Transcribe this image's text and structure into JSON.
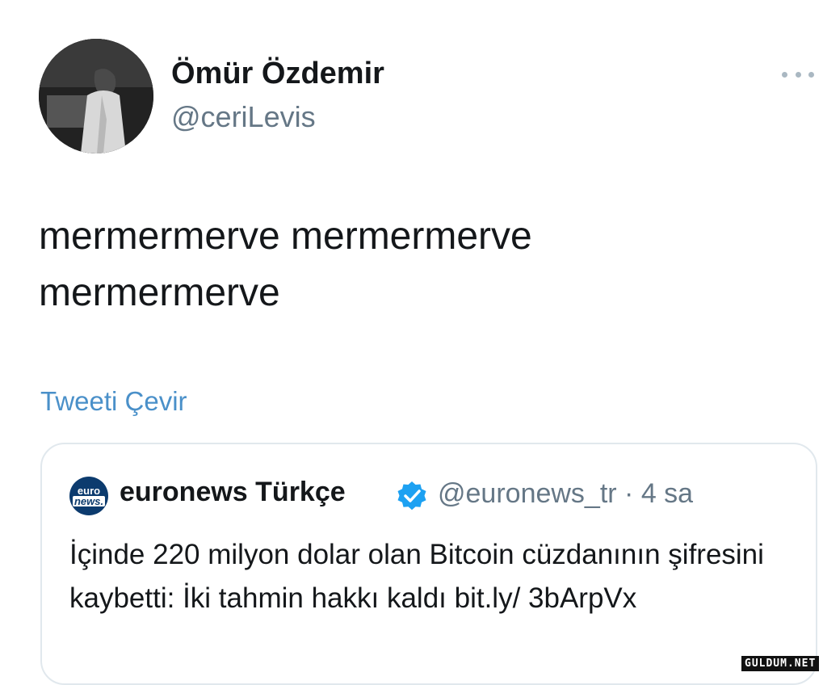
{
  "tweet": {
    "author": {
      "display_name": "Ömür Özdemir",
      "handle": "@ceriLevis",
      "avatar_icon": "user-photo"
    },
    "more_icon": "more-horizontal-icon",
    "text": "mermermerve mermermerve mermermerve",
    "translate_link": "Tweeti Çevir"
  },
  "quoted_tweet": {
    "logo_line1": "euro",
    "logo_line2": "news.",
    "display_name": "euronews Türkçe",
    "verified_icon": "verified-badge-icon",
    "handle_meta": "@euronews_tr · 4 sa",
    "text": "İçinde 220 milyon dolar olan Bitcoin cüzdanının şifresini kaybetti: İki tahmin hakkı kaldı  bit.ly/ 3bArpVx"
  },
  "watermark": "GULDUM.NET",
  "colors": {
    "link": "#4a90c9",
    "verified": "#1da1f2",
    "secondary_text": "#657786",
    "border": "#e1e8ed"
  }
}
